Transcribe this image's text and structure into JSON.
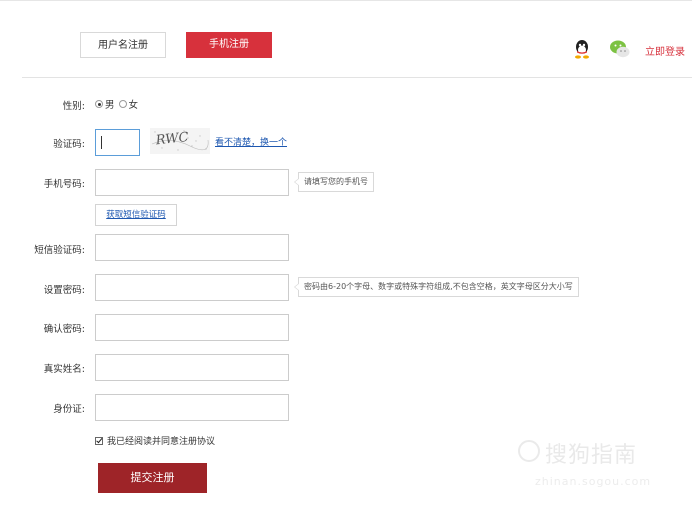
{
  "tabs": {
    "username_label": "用户名注册",
    "phone_label": "手机注册"
  },
  "header": {
    "qq_icon": "qq-penguin-icon",
    "wechat_icon": "wechat-icon",
    "login_link": "立即登录"
  },
  "form": {
    "gender": {
      "label": "性别:",
      "options": [
        "男",
        "女"
      ],
      "selected": "男"
    },
    "captcha": {
      "label": "验证码:",
      "value": "",
      "image_text": "RWC",
      "refresh_link": "看不清楚，换一个"
    },
    "phone": {
      "label": "手机号码:",
      "value": "",
      "tip": "请填写您的手机号"
    },
    "sms_button": "获取短信验证码",
    "sms_code": {
      "label": "短信验证码:",
      "value": ""
    },
    "password": {
      "label": "设置密码:",
      "value": "",
      "tip": "密码由6-20个字母、数字或特殊字符组成,不包含空格，英文字母区分大小写"
    },
    "confirm_password": {
      "label": "确认密码:",
      "value": ""
    },
    "real_name": {
      "label": "真实姓名:",
      "value": ""
    },
    "id_card": {
      "label": "身份证:",
      "value": ""
    },
    "agreement": {
      "label": "我已经阅读并同意注册协议",
      "checked": true
    },
    "submit_label": "提交注册"
  },
  "watermark": {
    "brand": "搜狗指南",
    "url": "zhinan.sogou.com"
  },
  "colors": {
    "accent_red": "#d7313c",
    "submit_dark_red": "#9e2428",
    "link_blue": "#1d57b0"
  }
}
